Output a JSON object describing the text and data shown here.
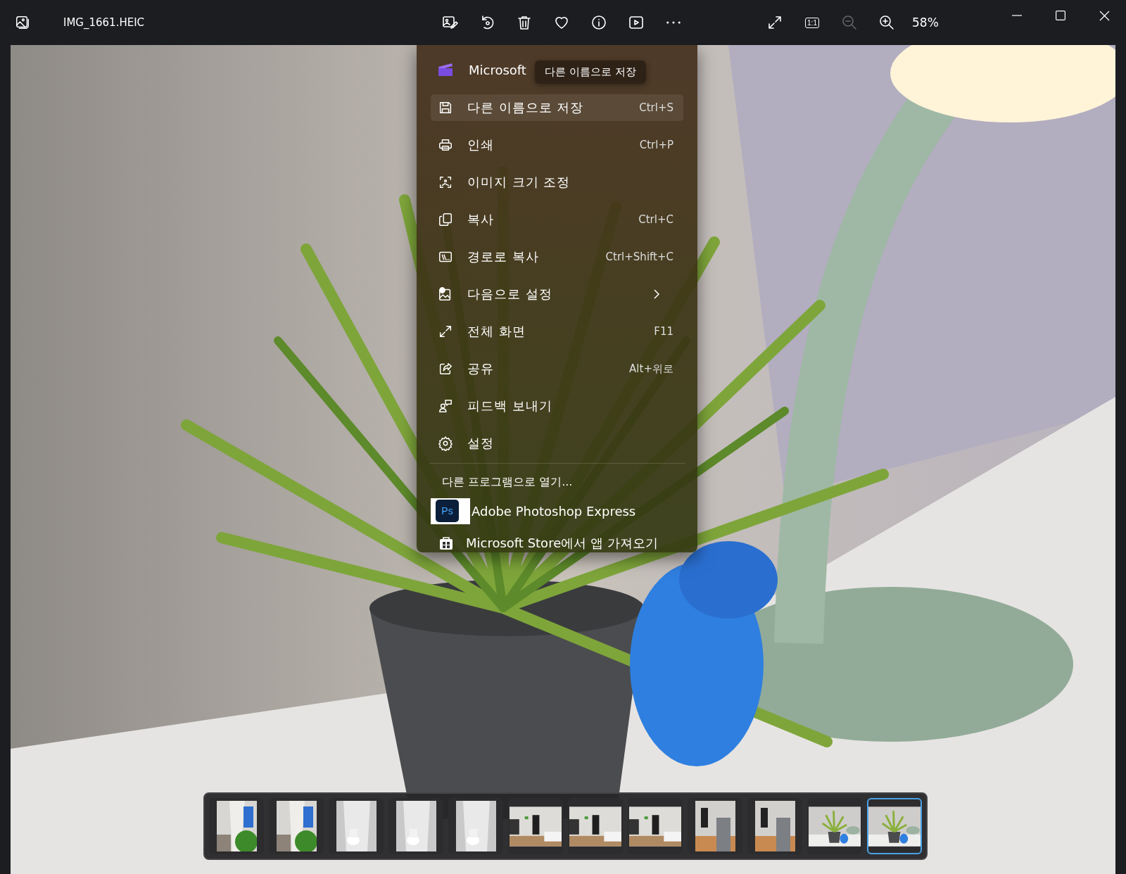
{
  "window": {
    "title": "IMG_1661.HEIC"
  },
  "toolbar": [
    {
      "kind": "edit",
      "disabled": false
    },
    {
      "kind": "rotate",
      "disabled": false
    },
    {
      "kind": "delete",
      "disabled": false
    },
    {
      "kind": "favorite",
      "disabled": false
    },
    {
      "kind": "info",
      "disabled": false
    },
    {
      "kind": "slideshow",
      "disabled": false
    },
    {
      "kind": "more",
      "disabled": false
    }
  ],
  "view_controls": [
    {
      "kind": "fullscreen",
      "disabled": false
    },
    {
      "kind": "actual-size",
      "label": "1:1",
      "disabled": false
    },
    {
      "kind": "zoom-out",
      "disabled": true
    },
    {
      "kind": "zoom-in",
      "disabled": false
    }
  ],
  "zoom": "58%",
  "menu": {
    "top_app": {
      "label": "Microsoft"
    },
    "tooltip": "다른 이름으로 저장",
    "items": [
      {
        "kind": "save",
        "label": "다른 이름으로 저장",
        "shortcut": "Ctrl+S",
        "hovered": true,
        "submenu": false
      },
      {
        "kind": "print",
        "label": "인쇄",
        "shortcut": "Ctrl+P",
        "hovered": false,
        "submenu": false
      },
      {
        "kind": "resize",
        "label": "이미지 크기 조정",
        "hovered": false,
        "submenu": false
      },
      {
        "kind": "copy",
        "label": "복사",
        "shortcut": "Ctrl+C",
        "hovered": false,
        "submenu": false
      },
      {
        "kind": "path",
        "label": "경로로 복사",
        "shortcut": "Ctrl+Shift+C",
        "hovered": false,
        "submenu": false
      },
      {
        "kind": "set-as",
        "label": "다음으로 설정",
        "hovered": false,
        "submenu": true
      },
      {
        "kind": "fullscreen",
        "label": "전체 화면",
        "shortcut": "F11",
        "hovered": false,
        "submenu": false
      },
      {
        "kind": "share",
        "label": "공유",
        "shortcut": "Alt+위로",
        "hovered": false,
        "submenu": false
      },
      {
        "kind": "feedback",
        "label": "피드백 보내기",
        "hovered": false,
        "submenu": false
      },
      {
        "kind": "settings",
        "label": "설정",
        "hovered": false,
        "submenu": false
      }
    ],
    "open_with": {
      "heading": "다른 프로그램으로 열기...",
      "apps": [
        {
          "kind": "photoshop",
          "logo_text": "Ps",
          "label": "Adobe Photoshop Express"
        },
        {
          "kind": "store",
          "label": "Microsoft Store에서 앱 가져오기"
        }
      ]
    }
  },
  "filmstrip": [
    {
      "kind": "hallway",
      "selected": false
    },
    {
      "kind": "hallway",
      "selected": false
    },
    {
      "kind": "bathroom",
      "selected": false
    },
    {
      "kind": "bathroom",
      "selected": false
    },
    {
      "kind": "bathroom",
      "selected": false
    },
    {
      "kind": "bedroom",
      "selected": false
    },
    {
      "kind": "bedroom",
      "selected": false
    },
    {
      "kind": "bedroom",
      "selected": false
    },
    {
      "kind": "kitchen",
      "selected": false
    },
    {
      "kind": "kitchen",
      "selected": false
    },
    {
      "kind": "plant",
      "selected": false
    },
    {
      "kind": "plant",
      "selected": true
    }
  ]
}
